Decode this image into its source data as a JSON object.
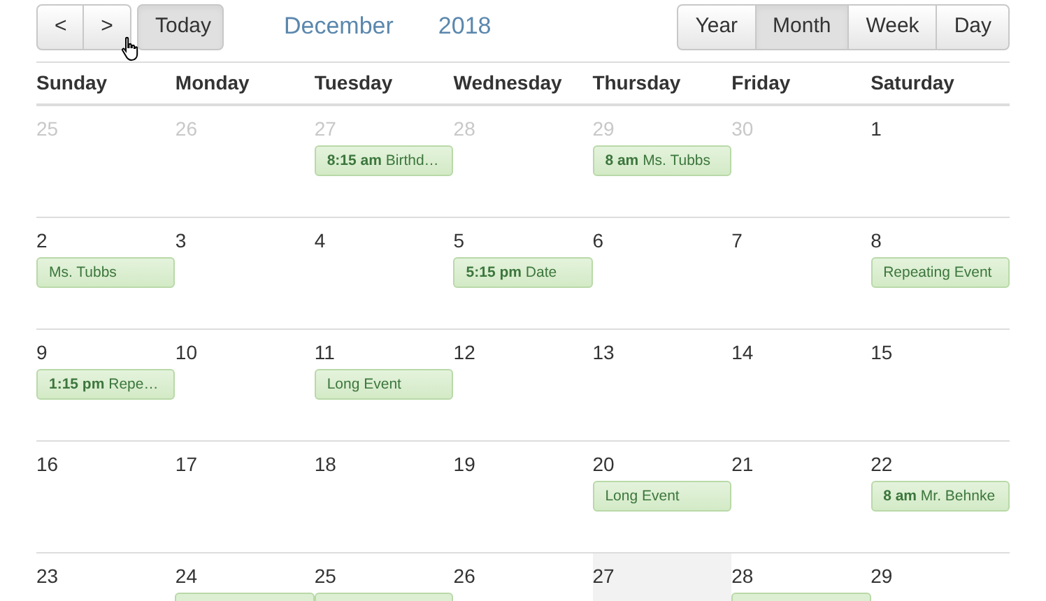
{
  "toolbar": {
    "nav_buttons": [
      {
        "label": "<"
      },
      {
        "label": ">"
      }
    ],
    "today_button": {
      "label": "Today",
      "disabled": true
    },
    "month": "December",
    "year": "2018",
    "views": [
      {
        "label": "Year",
        "selected": false
      },
      {
        "label": "Month",
        "selected": true
      },
      {
        "label": "Week",
        "selected": false
      },
      {
        "label": "Day",
        "selected": false
      }
    ]
  },
  "weekdays": [
    "Sunday",
    "Monday",
    "Tuesday",
    "Wednesday",
    "Thursday",
    "Friday",
    "Saturday"
  ],
  "weeks": [
    {
      "days": [
        {
          "number": "25",
          "other_month": true,
          "today": false
        },
        {
          "number": "26",
          "other_month": true,
          "today": false
        },
        {
          "number": "27",
          "other_month": true,
          "today": false,
          "events": [
            {
              "time": "8:15 am",
              "title": "Birthd…"
            }
          ]
        },
        {
          "number": "28",
          "other_month": true,
          "today": false
        },
        {
          "number": "29",
          "other_month": true,
          "today": false,
          "events": [
            {
              "time": "8 am",
              "title": "Ms. Tubbs"
            }
          ]
        },
        {
          "number": "30",
          "other_month": true,
          "today": false
        },
        {
          "number": "1",
          "other_month": false,
          "today": false
        }
      ]
    },
    {
      "days": [
        {
          "number": "2",
          "other_month": false,
          "today": false,
          "events": [
            {
              "title": "Ms. Tubbs"
            }
          ]
        },
        {
          "number": "3",
          "other_month": false,
          "today": false
        },
        {
          "number": "4",
          "other_month": false,
          "today": false
        },
        {
          "number": "5",
          "other_month": false,
          "today": false,
          "events": [
            {
              "time": "5:15 pm",
              "title": "Date"
            }
          ]
        },
        {
          "number": "6",
          "other_month": false,
          "today": false
        },
        {
          "number": "7",
          "other_month": false,
          "today": false
        },
        {
          "number": "8",
          "other_month": false,
          "today": false,
          "events": [
            {
              "title": "Repeating Event"
            }
          ]
        }
      ]
    },
    {
      "days": [
        {
          "number": "9",
          "other_month": false,
          "today": false,
          "events": [
            {
              "time": "1:15 pm",
              "title": "Repe…"
            }
          ]
        },
        {
          "number": "10",
          "other_month": false,
          "today": false
        },
        {
          "number": "11",
          "other_month": false,
          "today": false,
          "events": [
            {
              "title": "Long Event"
            }
          ]
        },
        {
          "number": "12",
          "other_month": false,
          "today": false
        },
        {
          "number": "13",
          "other_month": false,
          "today": false
        },
        {
          "number": "14",
          "other_month": false,
          "today": false
        },
        {
          "number": "15",
          "other_month": false,
          "today": false
        }
      ]
    },
    {
      "days": [
        {
          "number": "16",
          "other_month": false,
          "today": false
        },
        {
          "number": "17",
          "other_month": false,
          "today": false
        },
        {
          "number": "18",
          "other_month": false,
          "today": false
        },
        {
          "number": "19",
          "other_month": false,
          "today": false
        },
        {
          "number": "20",
          "other_month": false,
          "today": false,
          "events": [
            {
              "title": "Long Event"
            }
          ]
        },
        {
          "number": "21",
          "other_month": false,
          "today": false
        },
        {
          "number": "22",
          "other_month": false,
          "today": false,
          "events": [
            {
              "time": "8 am",
              "title": "Mr. Behnke"
            }
          ]
        }
      ]
    },
    {
      "days": [
        {
          "number": "23",
          "other_month": false,
          "today": false
        },
        {
          "number": "24",
          "other_month": false,
          "today": false,
          "events": [
            {
              "kind": "cut"
            }
          ]
        },
        {
          "number": "25",
          "other_month": false,
          "today": false,
          "events": [
            {
              "kind": "cut"
            }
          ]
        },
        {
          "number": "26",
          "other_month": false,
          "today": false
        },
        {
          "number": "27",
          "other_month": false,
          "today": true
        },
        {
          "number": "28",
          "other_month": false,
          "today": false,
          "events": [
            {
              "kind": "cut"
            }
          ]
        },
        {
          "number": "29",
          "other_month": false,
          "today": false
        }
      ]
    }
  ]
}
